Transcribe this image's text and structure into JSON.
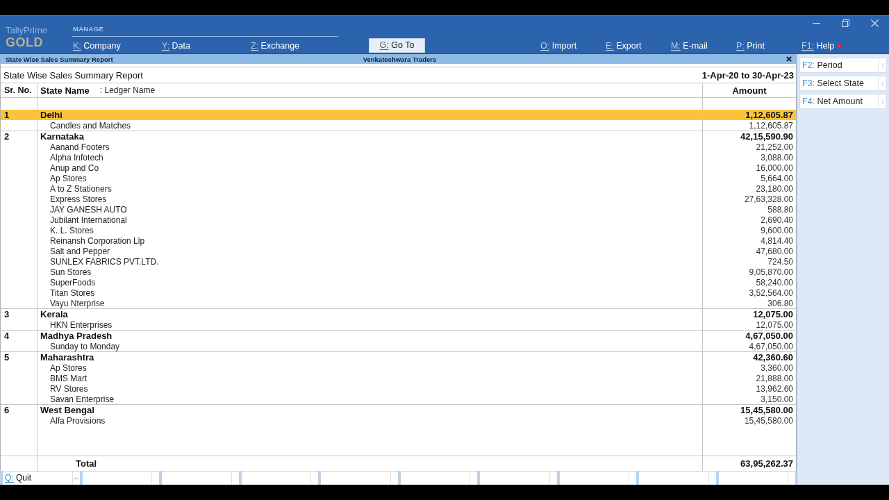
{
  "app": {
    "name": "TallyPrime",
    "edition": "GOLD"
  },
  "toolbar": {
    "manage_label": "MANAGE",
    "manage_items": [
      {
        "key": "K:",
        "label": "Company"
      },
      {
        "key": "Y:",
        "label": "Data"
      },
      {
        "key": "Z:",
        "label": "Exchange"
      }
    ],
    "goto": {
      "key": "G:",
      "label": "Go To"
    },
    "actions": [
      {
        "key": "O:",
        "label": "Import",
        "alert": false
      },
      {
        "key": "E:",
        "label": "Export",
        "alert": false
      },
      {
        "key": "M:",
        "label": "E-mail",
        "alert": false
      },
      {
        "key": "P:",
        "label": "Print",
        "alert": false
      },
      {
        "key": "F1:",
        "label": "Help",
        "alert": true
      }
    ]
  },
  "window_bar": {
    "title": "State Wise Sales Summary Report",
    "company": "Venkateshwara Traders"
  },
  "report": {
    "title": "State Wise Sales Summary Report",
    "period": "1-Apr-20 to 30-Apr-23",
    "columns": {
      "sr": "Sr. No.",
      "state": "State Name",
      "ledger": ": Ledger Name",
      "amount": "Amount"
    },
    "states": [
      {
        "sr": "1",
        "name": "Delhi",
        "amount": "1,12,605.87",
        "selected": true,
        "children": [
          {
            "name": "Candles and Matches",
            "amount": "1,12,605.87"
          }
        ]
      },
      {
        "sr": "2",
        "name": "Karnataka",
        "amount": "42,15,590.90",
        "selected": false,
        "children": [
          {
            "name": "Aanand Footers",
            "amount": "21,252.00"
          },
          {
            "name": "Alpha Infotech",
            "amount": "3,088.00"
          },
          {
            "name": "Anup and Co",
            "amount": "16,000.00"
          },
          {
            "name": "Ap Stores",
            "amount": "5,664.00"
          },
          {
            "name": "A to Z Stationers",
            "amount": "23,180.00"
          },
          {
            "name": "Express Stores",
            "amount": "27,63,328.00"
          },
          {
            "name": "JAY GANESH AUTO",
            "amount": "588.80"
          },
          {
            "name": "Jubilant International",
            "amount": "2,690.40"
          },
          {
            "name": "K. L. Stores",
            "amount": "9,600.00"
          },
          {
            "name": "Reinansh Corporation Llp",
            "amount": "4,814.40"
          },
          {
            "name": "Salt and Pepper",
            "amount": "47,680.00"
          },
          {
            "name": "SUNLEX FABRICS PVT.LTD.",
            "amount": "724.50"
          },
          {
            "name": "Sun Stores",
            "amount": "9,05,870.00"
          },
          {
            "name": "SuperFoods",
            "amount": "58,240.00"
          },
          {
            "name": "Titan Stores",
            "amount": "3,52,564.00"
          },
          {
            "name": "Vayu Nterprise",
            "amount": "306.80"
          }
        ]
      },
      {
        "sr": "3",
        "name": "Kerala",
        "amount": "12,075.00",
        "selected": false,
        "children": [
          {
            "name": "HKN Enterprises",
            "amount": "12,075.00"
          }
        ]
      },
      {
        "sr": "4",
        "name": "Madhya Pradesh",
        "amount": "4,67,050.00",
        "selected": false,
        "children": [
          {
            "name": "Sunday to Monday",
            "amount": "4,67,050.00"
          }
        ]
      },
      {
        "sr": "5",
        "name": "Maharashtra",
        "amount": "42,360.60",
        "selected": false,
        "children": [
          {
            "name": "Ap Stores",
            "amount": "3,360.00"
          },
          {
            "name": "BMS Mart",
            "amount": "21,888.00"
          },
          {
            "name": "RV Stores",
            "amount": "13,962.60"
          },
          {
            "name": "Savan Enterprise",
            "amount": "3,150.00"
          }
        ]
      },
      {
        "sr": "6",
        "name": "West Bengal",
        "amount": "15,45,580.00",
        "selected": false,
        "children": [
          {
            "name": "Alfa Provisions",
            "amount": "15,45,580.00"
          }
        ]
      }
    ],
    "total": {
      "label": "Total",
      "amount": "63,95,262.37"
    }
  },
  "sidebar": {
    "buttons": [
      {
        "key": "F2:",
        "label": "Period"
      },
      {
        "key": "F3:",
        "label": "Select State"
      },
      {
        "key": "F4:",
        "label": "Net Amount"
      }
    ]
  },
  "footer": {
    "buttons": [
      {
        "key": "Q:",
        "label": "Quit"
      }
    ]
  }
}
